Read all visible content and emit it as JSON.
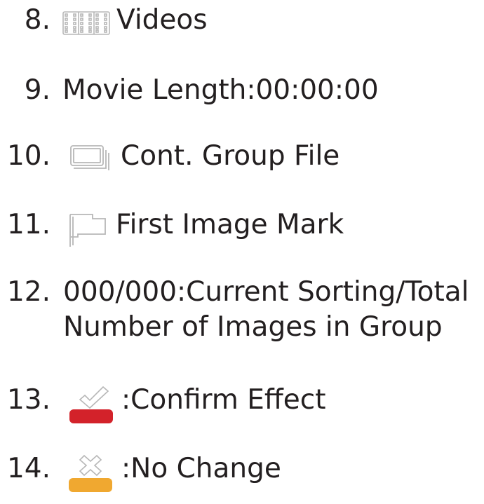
{
  "items": [
    {
      "number": "8.",
      "icon": "film-strip-icon",
      "text": "Videos"
    },
    {
      "number": "9.",
      "text": "Movie Length:00:00:00"
    },
    {
      "number": "10.",
      "icon": "continuous-group-icon",
      "text": "Cont. Group File"
    },
    {
      "number": "11.",
      "icon": "flag-icon",
      "text": "First Image Mark"
    },
    {
      "number": "12.",
      "text_line1": "000/000:Current Sorting/Total",
      "text_line2": "Number of Images in Group"
    },
    {
      "number": "13.",
      "icon": "check-mark-icon",
      "text": ":Confirm Effect"
    },
    {
      "number": "14.",
      "icon": "cross-mark-icon",
      "text": ":No Change"
    }
  ],
  "colors": {
    "text": "#231f20",
    "icon_stroke": "#b7b7b7",
    "confirm_bar": "#d3222a",
    "no_change_bar": "#f0a830"
  }
}
